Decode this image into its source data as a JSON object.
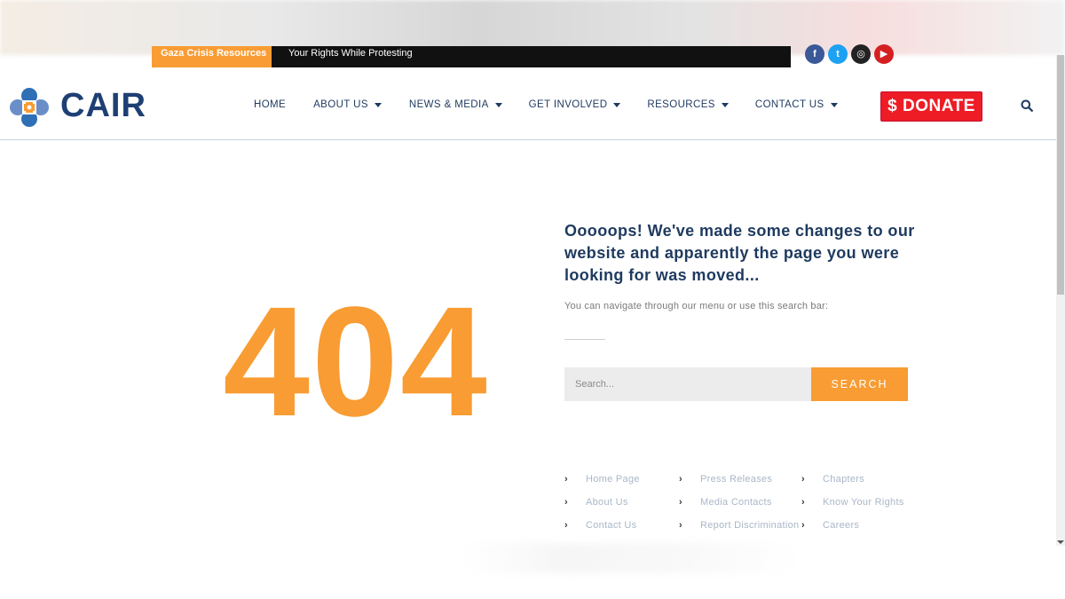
{
  "ticker": {
    "label": "Gaza Crisis Resources",
    "text": "Your Rights While Protesting"
  },
  "social": {
    "icons": [
      "facebook-icon",
      "twitter-icon",
      "instagram-icon",
      "youtube-icon"
    ],
    "glyphs": [
      "f",
      "t",
      "◎",
      "▶"
    ]
  },
  "header": {
    "logo_text": "CAIR",
    "nav": [
      {
        "label": "HOME",
        "has_dropdown": false
      },
      {
        "label": "ABOUT US",
        "has_dropdown": true
      },
      {
        "label": "NEWS & MEDIA",
        "has_dropdown": true
      },
      {
        "label": "GET INVOLVED",
        "has_dropdown": true
      },
      {
        "label": "RESOURCES",
        "has_dropdown": true
      },
      {
        "label": "CONTACT US",
        "has_dropdown": true
      }
    ],
    "donate_label": "$ DONATE"
  },
  "error": {
    "code": "404",
    "heading": "Ooooops! We've made some changes to our website and apparently the page you were looking for was moved...",
    "subtext": "You can navigate through our menu or use this search bar:"
  },
  "search": {
    "placeholder": "Search...",
    "button_label": "SEARCH"
  },
  "links": {
    "col1": [
      "Home Page",
      "About Us",
      "Contact Us"
    ],
    "col2": [
      "Press Releases",
      "Media Contacts",
      "Report Discrimination"
    ],
    "col3": [
      "Chapters",
      "Know Your Rights",
      "Careers"
    ]
  },
  "colors": {
    "accent_orange": "#f89c33",
    "navy": "#1e3a5f",
    "donate_red": "#ee1c25"
  }
}
